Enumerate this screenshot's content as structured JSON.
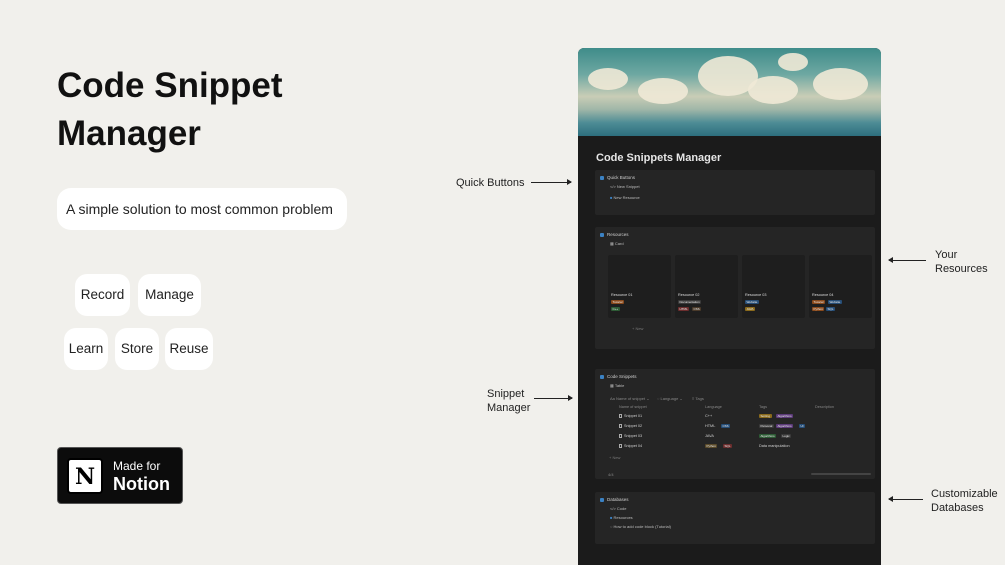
{
  "hero": {
    "title_line1": "Code Snippet",
    "title_line2": "Manager",
    "tagline": "A simple solution to most common problem"
  },
  "features": [
    "Record",
    "Manage",
    "Learn",
    "Store",
    "Reuse"
  ],
  "badge": {
    "made_for": "Made for",
    "brand": "Notion",
    "logo_letter": "N"
  },
  "callouts": {
    "quick_buttons": "Quick Buttons",
    "snippet_manager_1": "Snippet",
    "snippet_manager_2": "Manager",
    "your_resources_1": "Your",
    "your_resources_2": "Resources",
    "customizable_1": "Customizable",
    "customizable_2": "Databases"
  },
  "notion_page": {
    "title": "Code Snippets Manager",
    "quick_buttons": {
      "heading": "Quick Buttons",
      "items": [
        "New Snippet",
        "New Resource"
      ]
    },
    "resources": {
      "heading": "Resources",
      "view": "Card",
      "new_label": "+ New",
      "cards": [
        {
          "name": "Resource 01",
          "tags": [
            "Tutorial",
            "C++"
          ],
          "tag_colors": [
            "#8a4a1c",
            "#2d5b35"
          ]
        },
        {
          "name": "Resource 02",
          "tags": [
            "Documentation",
            "HTML",
            "CSS"
          ],
          "tag_colors": [
            "#3a3a3a",
            "#6b2d2d",
            "#4a3a2a"
          ]
        },
        {
          "name": "Resource 03",
          "tags": [
            "Website",
            "JAVA"
          ],
          "tag_colors": [
            "#264e78",
            "#8a6a1c"
          ]
        },
        {
          "name": "Resource 04",
          "tags": [
            "Tutorial",
            "Website",
            "Python",
            "SQL"
          ],
          "tag_colors": [
            "#8a4a1c",
            "#264e78",
            "#8a4a1c",
            "#264e78"
          ]
        }
      ]
    },
    "code_snippets": {
      "heading": "Code Snippets",
      "view": "Table",
      "filters": [
        "Name of snippet",
        "Language",
        "Tags"
      ],
      "columns": [
        "Name of snippet",
        "Language",
        "Tags",
        "Description"
      ],
      "rows": [
        {
          "name": "Snippet 01",
          "language": [
            "C++"
          ],
          "tags": [
            "Sorting",
            "Algorithms"
          ],
          "description": ""
        },
        {
          "name": "Snippet 02",
          "language": [
            "HTML",
            "CSS"
          ],
          "tags": [
            "Personal",
            "Algorithms",
            "UI"
          ],
          "description": ""
        },
        {
          "name": "Snippet 03",
          "language": [
            "JAVA"
          ],
          "tags": [
            "Algorithms",
            "Logic"
          ],
          "description": ""
        },
        {
          "name": "Snippet 04",
          "language": [
            "Python",
            "SQL"
          ],
          "tags": [],
          "description": "Data manipulation"
        }
      ],
      "new_label": "+ New",
      "count_label": "4/4"
    },
    "databases": {
      "heading": "Databases",
      "items": [
        "Code",
        "Resources",
        "How to add code block (Tutorial)"
      ]
    }
  }
}
